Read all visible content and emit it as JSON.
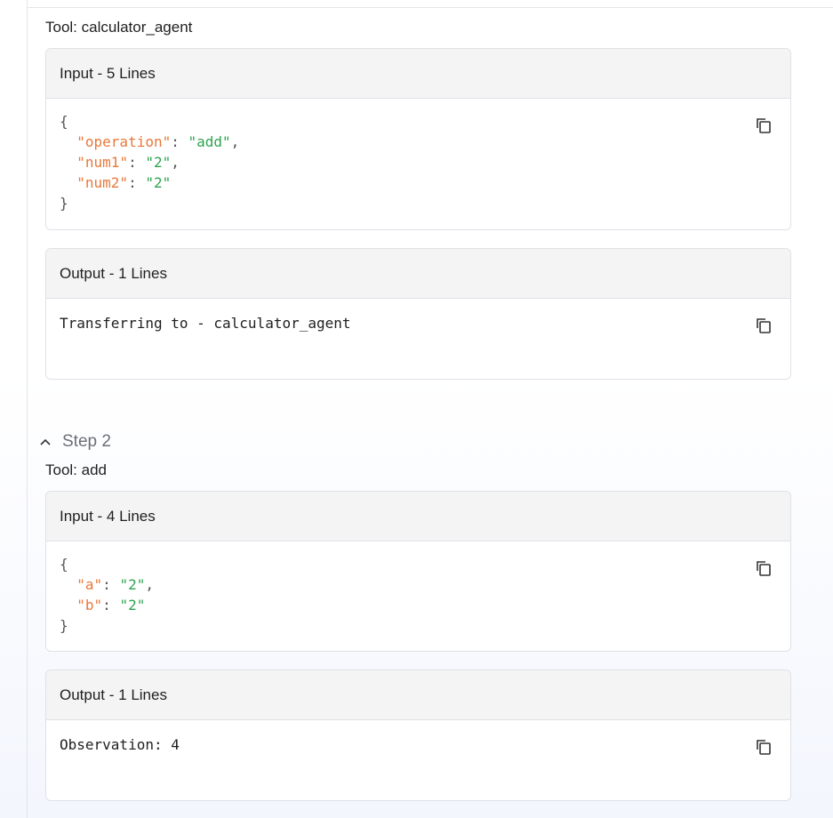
{
  "steps": [
    {
      "tool_prefix": "Tool: ",
      "tool_name": "calculator_agent",
      "input": {
        "header": "Input - 5 Lines",
        "lines": [
          [
            {
              "t": "{",
              "c": "p"
            }
          ],
          [
            {
              "t": "  ",
              "c": "p"
            },
            {
              "t": "\"operation\"",
              "c": "k"
            },
            {
              "t": ": ",
              "c": "p"
            },
            {
              "t": "\"add\"",
              "c": "s"
            },
            {
              "t": ",",
              "c": "p"
            }
          ],
          [
            {
              "t": "  ",
              "c": "p"
            },
            {
              "t": "\"num1\"",
              "c": "k"
            },
            {
              "t": ": ",
              "c": "p"
            },
            {
              "t": "\"2\"",
              "c": "s"
            },
            {
              "t": ",",
              "c": "p"
            }
          ],
          [
            {
              "t": "  ",
              "c": "p"
            },
            {
              "t": "\"num2\"",
              "c": "k"
            },
            {
              "t": ": ",
              "c": "p"
            },
            {
              "t": "\"2\"",
              "c": "s"
            }
          ],
          [
            {
              "t": "}",
              "c": "p"
            }
          ]
        ]
      },
      "output": {
        "header": "Output - 1 Lines",
        "text": "Transferring to - calculator_agent"
      }
    },
    {
      "label": "Step 2",
      "tool_prefix": "Tool: ",
      "tool_name": "add",
      "input": {
        "header": "Input - 4 Lines",
        "lines": [
          [
            {
              "t": "{",
              "c": "p"
            }
          ],
          [
            {
              "t": "  ",
              "c": "p"
            },
            {
              "t": "\"a\"",
              "c": "k"
            },
            {
              "t": ": ",
              "c": "p"
            },
            {
              "t": "\"2\"",
              "c": "s"
            },
            {
              "t": ",",
              "c": "p"
            }
          ],
          [
            {
              "t": "  ",
              "c": "p"
            },
            {
              "t": "\"b\"",
              "c": "k"
            },
            {
              "t": ": ",
              "c": "p"
            },
            {
              "t": "\"2\"",
              "c": "s"
            }
          ],
          [
            {
              "t": "}",
              "c": "p"
            }
          ]
        ]
      },
      "output": {
        "header": "Output - 1 Lines",
        "text": "Observation: 4"
      }
    }
  ],
  "icons": {
    "copy": "copy-icon",
    "chevron": "chevron-up-icon"
  },
  "colors": {
    "json_key": "#e8783a",
    "json_string": "#2ea44f",
    "card_header_bg": "#f4f4f5",
    "border": "#dfe1e6"
  }
}
